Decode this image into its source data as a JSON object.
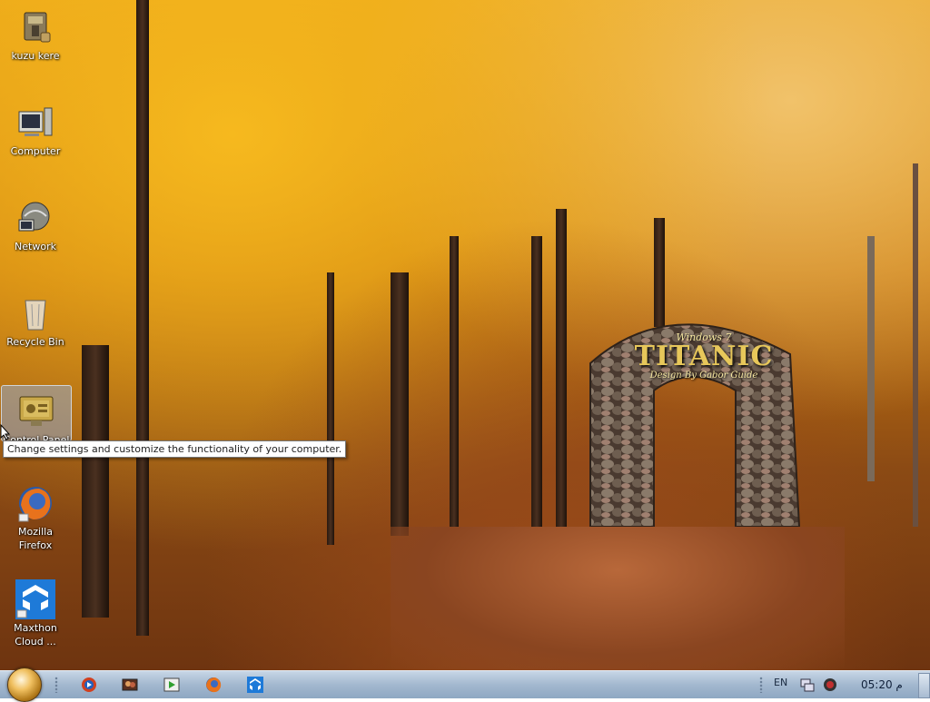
{
  "desktop": {
    "icons": [
      {
        "label": "kuzu kere",
        "icon": "archive-icon"
      },
      {
        "label": "Computer",
        "icon": "computer-icon"
      },
      {
        "label": "Network",
        "icon": "network-icon"
      },
      {
        "label": "Recycle Bin",
        "icon": "recycle-bin-icon"
      },
      {
        "label": "Control Panel",
        "icon": "control-panel-icon"
      },
      {
        "label": "Mozilla Firefox",
        "icon": "firefox-icon"
      },
      {
        "label": "Maxthon Cloud ...",
        "icon": "maxthon-icon"
      }
    ],
    "tooltip": "Change settings and customize the functionality of your computer.",
    "wallpaper_text": {
      "line1": "Windows 7",
      "line2": "TITANIC",
      "line3": "Design By Gabor Guide"
    }
  },
  "taskbar": {
    "pinned": [
      {
        "icon": "media-player-icon"
      },
      {
        "icon": "photos-icon"
      },
      {
        "icon": "video-player-icon"
      },
      {
        "icon": "firefox-icon"
      },
      {
        "icon": "maxthon-icon"
      }
    ],
    "language": "EN",
    "clock": "05:20 م"
  },
  "colors": {
    "taskbar": "#a3b8cf",
    "accent": "#e9a318"
  }
}
